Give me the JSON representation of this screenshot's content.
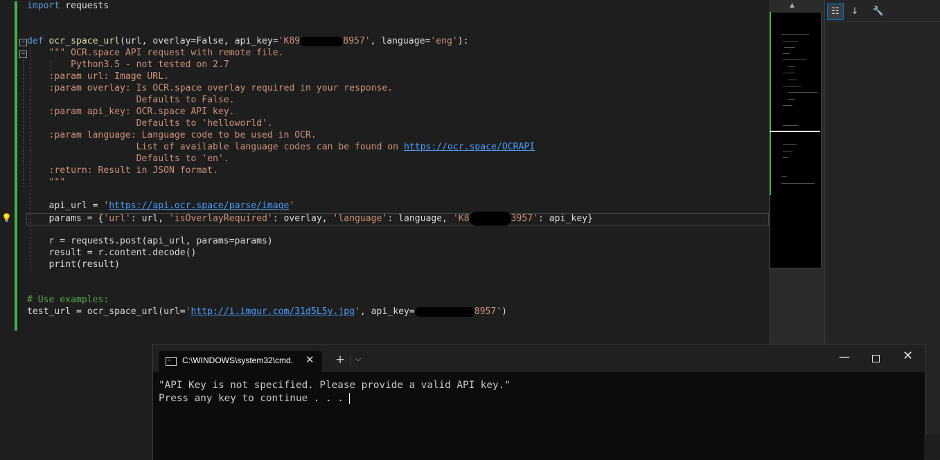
{
  "editor": {
    "lines": {
      "l1_kw": "import",
      "l1_rest": " requests",
      "l4_def": "def",
      "l4_fn": " ocr_space_url",
      "l4_a": "(url, overlay=False, api_key=",
      "l4_key": "'K89",
      "l4_key_end": "8957'",
      "l4_b": ", language=",
      "l4_lang": "'eng'",
      "l4_c": "):",
      "l5": "    \"\"\" OCR.space API request with remote file.",
      "l6": "        Python3.5 - not tested on 2.7",
      "l7": "    :param url: Image URL.",
      "l8": "    :param overlay: Is OCR.space overlay required in your response.",
      "l9": "                    Defaults to False.",
      "l10": "    :param api_key: OCR.space API key.",
      "l11": "                    Defaults to 'helloworld'.",
      "l12": "    :param language: Language code to be used in OCR.",
      "l13_a": "                    List of available language codes can be found on ",
      "l13_url": "https://ocr.space/OCRAPI",
      "l14": "                    Defaults to 'en'.",
      "l15": "    :return: Result in JSON format.",
      "l16": "    \"\"\"",
      "l18_a": "    api_url = ",
      "l18_q1": "'",
      "l18_url": "https://api.ocr.space/parse/image",
      "l18_q2": "'",
      "l19_a": "    params = {",
      "l19_s1": "'url'",
      "l19_b": ": url, ",
      "l19_s2": "'isOverlayRequired'",
      "l19_c": ": overlay, ",
      "l19_s3": "'language'",
      "l19_d": ": language, ",
      "l19_s4": "'K8",
      "l19_s4_end": "3957'",
      "l19_e": ": api_key}",
      "l21": "    r = requests.post(api_url, params=params)",
      "l22": "    result = r.content.decode()",
      "l23": "    print(result)",
      "l26": "# Use examples:",
      "l27_a": "test_url = ocr_space_url(url=",
      "l27_q1": "'",
      "l27_url": "http://i.imgur.com/31d5L5y.jpg",
      "l27_q2": "'",
      "l27_b": ", api_key=",
      "l27_key_end": "8957'",
      "l27_c": ")"
    }
  },
  "properties_toolbar": {
    "categorized_icon": "categorized-icon",
    "alphabetical_icon": "alphabetical-icon",
    "property_pages_icon": "wrench-icon"
  },
  "terminal": {
    "tab_title": "C:\\WINDOWS\\system32\\cmd.",
    "output_line1": "\"API Key is not specified. Please provide a valid API key.\"",
    "output_line2": "Press any key to continue . . . "
  }
}
